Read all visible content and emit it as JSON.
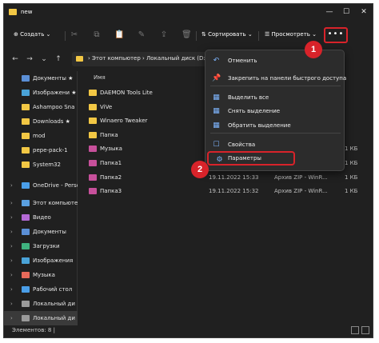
{
  "window": {
    "title": "new"
  },
  "title_controls": {
    "minimize": "—",
    "maximize": "☐",
    "close": "✕"
  },
  "toolbar": {
    "create_label": "⊕ Создать ⌄",
    "sort_label": "⇅ Сортировать ⌄",
    "view_label": "☰ Просмотреть ⌄",
    "more_label": "•••",
    "icons": [
      "cut-icon",
      "copy-icon",
      "paste-icon",
      "rename-icon",
      "share-icon",
      "delete-icon"
    ]
  },
  "address": {
    "path": "› Этот компьютер › Локальный диск (D:) › new"
  },
  "nav": {
    "back": "←",
    "forward": "→",
    "down": "⌄",
    "up": "↑"
  },
  "sidebar": {
    "items": [
      {
        "label": "Документы ★",
        "color": "#5b8fd6"
      },
      {
        "label": "Изображени ★",
        "color": "#4aa3d8"
      },
      {
        "label": "Ashampoo Sna",
        "color": "#f2c744"
      },
      {
        "label": "Downloads ★",
        "color": "#f2c744"
      },
      {
        "label": "mod",
        "color": "#f2c744"
      },
      {
        "label": "pepe-pack-1",
        "color": "#f2c744"
      },
      {
        "label": "System32",
        "color": "#f2c744"
      },
      {
        "label": "OneDrive - Perso",
        "color": "#4a9ee8"
      },
      {
        "label": "Этот компьютер",
        "color": "#5aa0e0"
      },
      {
        "label": "Видео",
        "color": "#b56ad6"
      },
      {
        "label": "Документы",
        "color": "#5b8fd6"
      },
      {
        "label": "Загрузки",
        "color": "#3fb27f"
      },
      {
        "label": "Изображения",
        "color": "#4aa3d8"
      },
      {
        "label": "Музыка",
        "color": "#e66a5a"
      },
      {
        "label": "Рабочий стол",
        "color": "#4a9ee8"
      },
      {
        "label": "Локальный ди",
        "color": "#9a9a9a"
      },
      {
        "label": "Локальный ди",
        "color": "#9a9a9a"
      }
    ]
  },
  "filelist": {
    "header_name": "Имя",
    "rows": [
      {
        "name": "DAEMON Tools Lite",
        "date": "",
        "type": "",
        "size": "",
        "color": "#f2c744"
      },
      {
        "name": "ViVe",
        "date": "",
        "type": "",
        "size": "",
        "color": "#f2c744"
      },
      {
        "name": "Winaero Tweaker",
        "date": "",
        "type": "",
        "size": "",
        "color": "#f2c744"
      },
      {
        "name": "Папка",
        "date": "",
        "type": "",
        "size": "",
        "color": "#f2c744"
      },
      {
        "name": "Музыка",
        "date": "",
        "type": "",
        "size": "1 КБ",
        "color": "#c7509b"
      },
      {
        "name": "Папка1",
        "date": "19.11.2022 15:34",
        "type": "Архив ZIP - WinR...",
        "size": "1 КБ",
        "color": "#c7509b"
      },
      {
        "name": "Папка2",
        "date": "19.11.2022 15:33",
        "type": "Архив ZIP - WinR...",
        "size": "1 КБ",
        "color": "#c7509b"
      },
      {
        "name": "Папка3",
        "date": "19.11.2022 15:32",
        "type": "Архив ZIP - WinR...",
        "size": "1 КБ",
        "color": "#c7509b"
      }
    ]
  },
  "menu": {
    "items": [
      {
        "label": "Отменить",
        "icon": "↶"
      },
      {
        "label": "Закрепить на панели быстрого доступа",
        "icon": "📌"
      },
      {
        "label": "Выделить все",
        "icon": "▦"
      },
      {
        "label": "Снять выделение",
        "icon": "▦"
      },
      {
        "label": "Обратить выделение",
        "icon": "▦"
      },
      {
        "label": "Свойства",
        "icon": "☐"
      },
      {
        "label": "Параметры",
        "icon": "⚙"
      }
    ]
  },
  "badges": {
    "one": "1",
    "two": "2"
  },
  "status": {
    "text": "Элементов: 8   |"
  },
  "colors": {
    "accent_red": "#d8232a",
    "bg": "#202020",
    "folder": "#f2c744"
  }
}
